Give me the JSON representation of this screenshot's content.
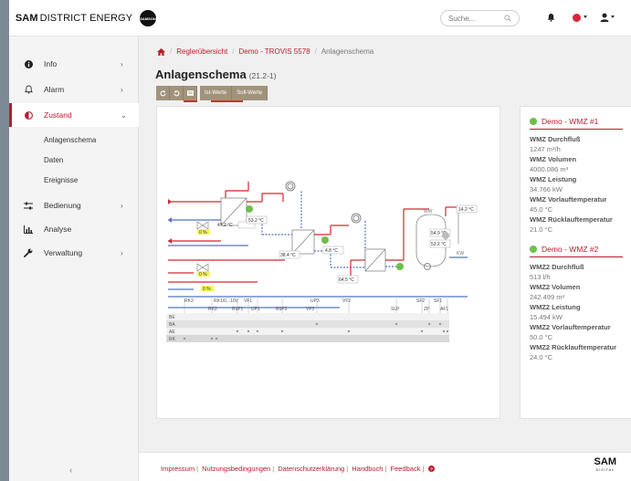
{
  "brand": {
    "name": "SAM",
    "suffix": "DISTRICT ENERGY",
    "samson_logo": "SAMSON"
  },
  "search": {
    "placeholder": "Suche..."
  },
  "colors": {
    "accent": "#b71c2c",
    "status_red": "#d7263d",
    "ok_green": "#6cc04a",
    "toolbar": "#a1937b"
  },
  "sidebar": {
    "items": [
      {
        "label": "Info",
        "icon": "info-icon"
      },
      {
        "label": "Alarm",
        "icon": "bell-icon"
      },
      {
        "label": "Zustand",
        "icon": "half-circle-icon"
      },
      {
        "label": "Bedienung",
        "icon": "sliders-icon"
      },
      {
        "label": "Analyse",
        "icon": "bar-chart-icon"
      },
      {
        "label": "Verwaltung",
        "icon": "wrench-icon"
      }
    ],
    "sub_items": [
      "Anlagenschema",
      "Daten",
      "Ereignisse"
    ]
  },
  "breadcrumb": {
    "home_icon": "home-icon",
    "items": [
      "Reglerübersicht",
      "Demo - TROVIS 5578",
      "Anlagenschema"
    ]
  },
  "page": {
    "title": "Anlagenschema",
    "subtitle": "(21.2-1)"
  },
  "toolbar": {
    "ist": "Ist-Werte",
    "soll": "Soll-Werte"
  },
  "diagram": {
    "temps": [
      "47.2 °C",
      "53.2 °C",
      "38.4 °C",
      "4.8 °C",
      "64.5 °C",
      "54.9 °C",
      "53.2 °C",
      "14.2 °C"
    ],
    "percents": [
      "0 %",
      "0 %",
      "0 %"
    ],
    "labels": [
      "RK3",
      "RK1/0...10V",
      "VF1",
      "RK2",
      "RüF1",
      "UP1",
      "RüF3",
      "UP3",
      "VF3",
      "VF2",
      "SLP",
      "SF2",
      "ZP",
      "SF1",
      "AF1",
      "WW",
      "KW"
    ],
    "rows": [
      "BE",
      "BA",
      "AE",
      "RK"
    ]
  },
  "wmz": [
    {
      "title": "Demo - WMZ #1",
      "fields": [
        {
          "label": "WMZ Durchfluß",
          "value": "1247 m³/h"
        },
        {
          "label": "WMZ Volumen",
          "value": "4000.086 m³"
        },
        {
          "label": "WMZ Leistung",
          "value": "34.766 kW"
        },
        {
          "label": "WMZ Vorlauftemperatur",
          "value": "45.0 °C"
        },
        {
          "label": "WMZ Rücklauftemperatur",
          "value": "21.0 °C"
        }
      ]
    },
    {
      "title": "Demo - WMZ #2",
      "fields": [
        {
          "label": "WMZ2 Durchfluß",
          "value": "513 l/h"
        },
        {
          "label": "WMZ2 Volumen",
          "value": "242.499 m³"
        },
        {
          "label": "WMZ2 Leistung",
          "value": "15.494 kW"
        },
        {
          "label": "WMZ2 Vorlauftemperatur",
          "value": "50.0 °C"
        },
        {
          "label": "WMZ2 Rücklauftemperatur",
          "value": "24.0 °C"
        }
      ]
    }
  ],
  "footer": {
    "links": [
      "Impressum",
      "Nutzungsbedingungen",
      "Datenschutzerklärung",
      "Handbuch",
      "Feedback"
    ],
    "help_icon": "help-icon",
    "logo": "SAM",
    "logo_sub": "DIGITAL"
  }
}
